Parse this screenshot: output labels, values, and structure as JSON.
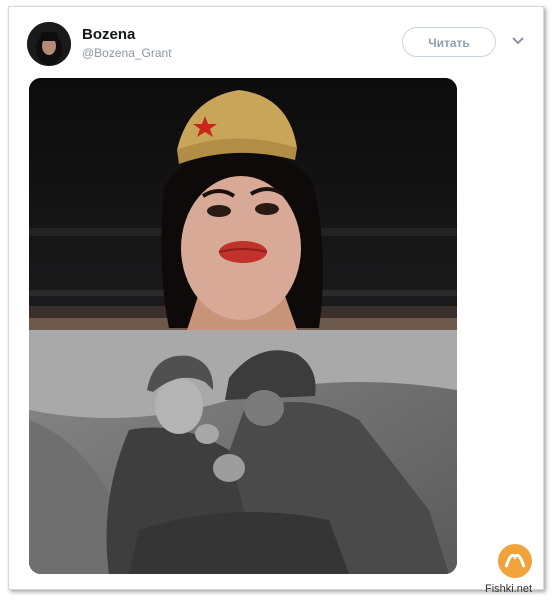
{
  "tweet": {
    "author_name": "Bozena",
    "author_handle": "@Bozena_Grant",
    "follow_label": "Читать",
    "avatar_icon": "user-avatar",
    "menu_icon": "chevron-down-icon"
  },
  "media": {
    "top_photo_icon": "photo-woman-in-garrison-cap",
    "bottom_photo_icon": "photo-soldiers-in-trench"
  },
  "watermark": {
    "logo_icon": "fishki-logo-icon",
    "text": "Fishki.net"
  },
  "colors": {
    "follow_border": "#c9d6df",
    "follow_text": "#8fa0b0",
    "cap": "#c9a55a",
    "star": "#c8261b"
  }
}
